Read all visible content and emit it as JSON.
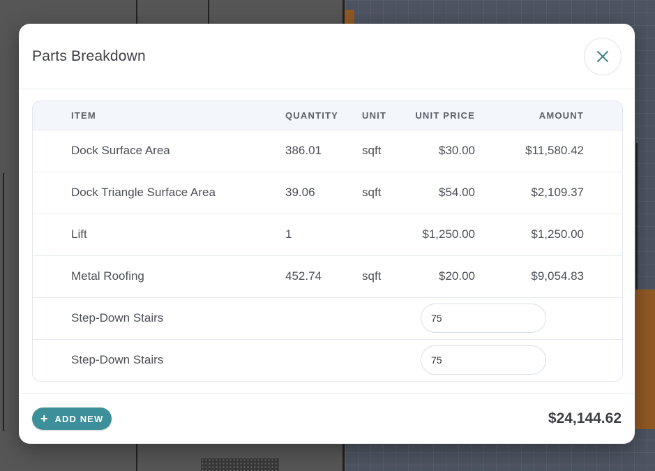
{
  "modal": {
    "title": "Parts Breakdown",
    "close_icon": "close-icon"
  },
  "table": {
    "headers": {
      "item": "ITEM",
      "quantity": "QUANTITY",
      "unit": "UNIT",
      "unit_price": "UNIT PRICE",
      "amount": "AMOUNT"
    },
    "rows": [
      {
        "item": "Dock Surface Area",
        "quantity": "386.01",
        "unit": "sqft",
        "unit_price": "$30.00",
        "amount": "$11,580.42"
      },
      {
        "item": "Dock Triangle Surface Area",
        "quantity": "39.06",
        "unit": "sqft",
        "unit_price": "$54.00",
        "amount": "$2,109.37"
      },
      {
        "item": "Lift",
        "quantity": "1",
        "unit": "",
        "unit_price": "$1,250.00",
        "amount": "$1,250.00"
      },
      {
        "item": "Metal Roofing",
        "quantity": "452.74",
        "unit": "sqft",
        "unit_price": "$20.00",
        "amount": "$9,054.83"
      },
      {
        "item": "Step-Down Stairs",
        "quantity": "",
        "unit": "",
        "unit_price": "",
        "amount_input": "75"
      },
      {
        "item": "Step-Down Stairs",
        "quantity": "",
        "unit": "",
        "unit_price": "",
        "amount_input": "75"
      }
    ]
  },
  "footer": {
    "add_button_label": "ADD NEW",
    "add_icon": "plus-icon",
    "total": "$24,144.62"
  },
  "colors": {
    "accent": "#3d8f9a",
    "close_icon": "#3d7f8a"
  }
}
